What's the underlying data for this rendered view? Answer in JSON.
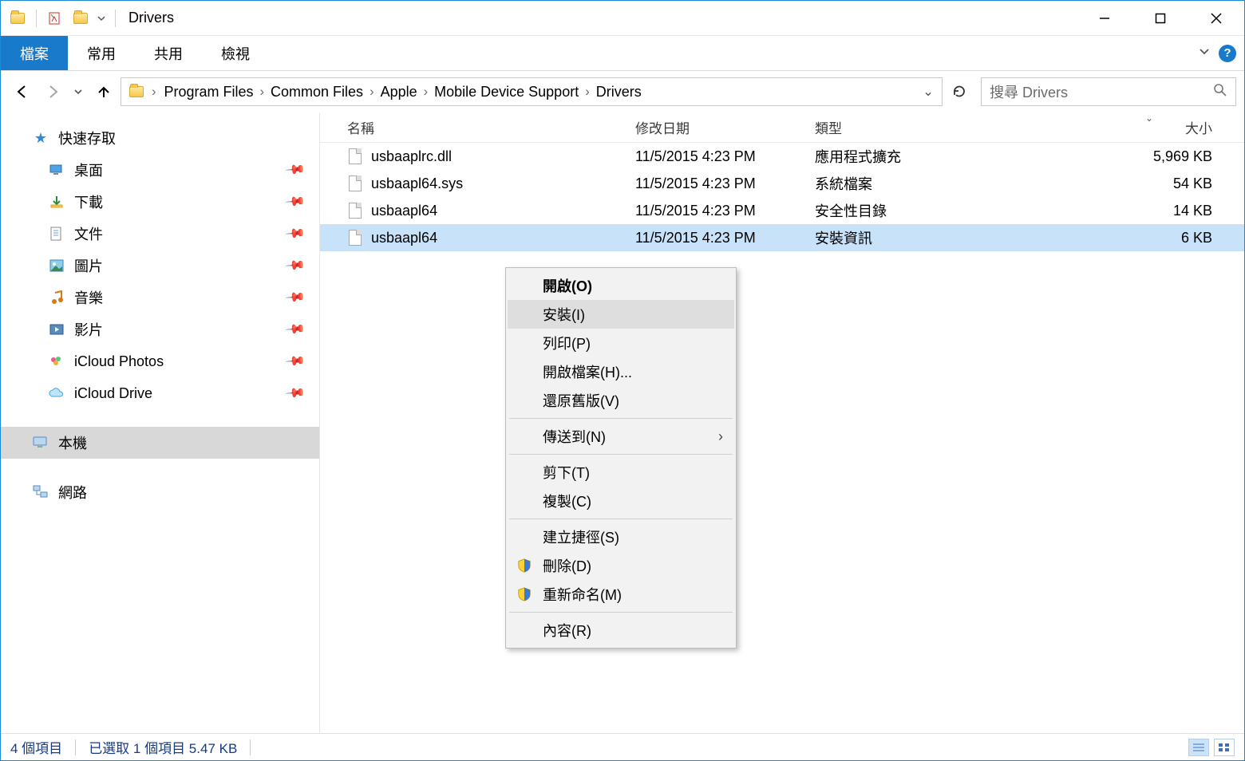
{
  "window": {
    "title": "Drivers"
  },
  "ribbon": {
    "file": "檔案",
    "tabs": [
      "常用",
      "共用",
      "檢視"
    ]
  },
  "breadcrumbs": [
    "Program Files",
    "Common Files",
    "Apple",
    "Mobile Device Support",
    "Drivers"
  ],
  "search_placeholder": "搜尋 Drivers",
  "sidebar": {
    "quick": "快速存取",
    "items": [
      {
        "label": "桌面",
        "icon": "desktop",
        "pinned": true
      },
      {
        "label": "下載",
        "icon": "download",
        "pinned": true
      },
      {
        "label": "文件",
        "icon": "docs",
        "pinned": true
      },
      {
        "label": "圖片",
        "icon": "pics",
        "pinned": true
      },
      {
        "label": "音樂",
        "icon": "music",
        "pinned": true
      },
      {
        "label": "影片",
        "icon": "video",
        "pinned": true
      },
      {
        "label": "iCloud Photos",
        "icon": "icloudp",
        "pinned": true
      },
      {
        "label": "iCloud Drive",
        "icon": "icloudd",
        "pinned": true
      }
    ],
    "thispc": "本機",
    "network": "網路"
  },
  "columns": {
    "name": "名稱",
    "date": "修改日期",
    "type": "類型",
    "size": "大小"
  },
  "files": [
    {
      "name": "usbaaplrc.dll",
      "date": "11/5/2015 4:23 PM",
      "type": "應用程式擴充",
      "size": "5,969 KB",
      "selected": false
    },
    {
      "name": "usbaapl64.sys",
      "date": "11/5/2015 4:23 PM",
      "type": "系統檔案",
      "size": "54 KB",
      "selected": false
    },
    {
      "name": "usbaapl64",
      "date": "11/5/2015 4:23 PM",
      "type": "安全性目錄",
      "size": "14 KB",
      "selected": false
    },
    {
      "name": "usbaapl64",
      "date": "11/5/2015 4:23 PM",
      "type": "安裝資訊",
      "size": "6 KB",
      "selected": true
    }
  ],
  "context_menu": [
    {
      "label": "開啟(O)",
      "bold": true
    },
    {
      "label": "安裝(I)",
      "hover": true
    },
    {
      "label": "列印(P)"
    },
    {
      "label": "開啟檔案(H)..."
    },
    {
      "label": "還原舊版(V)"
    },
    {
      "sep": true
    },
    {
      "label": "傳送到(N)",
      "submenu": true
    },
    {
      "sep": true
    },
    {
      "label": "剪下(T)"
    },
    {
      "label": "複製(C)"
    },
    {
      "sep": true
    },
    {
      "label": "建立捷徑(S)"
    },
    {
      "label": "刪除(D)",
      "shield": true
    },
    {
      "label": "重新命名(M)",
      "shield": true
    },
    {
      "sep": true
    },
    {
      "label": "內容(R)"
    }
  ],
  "status": {
    "count": "4 個項目",
    "selection": "已選取 1 個項目 5.47 KB"
  }
}
